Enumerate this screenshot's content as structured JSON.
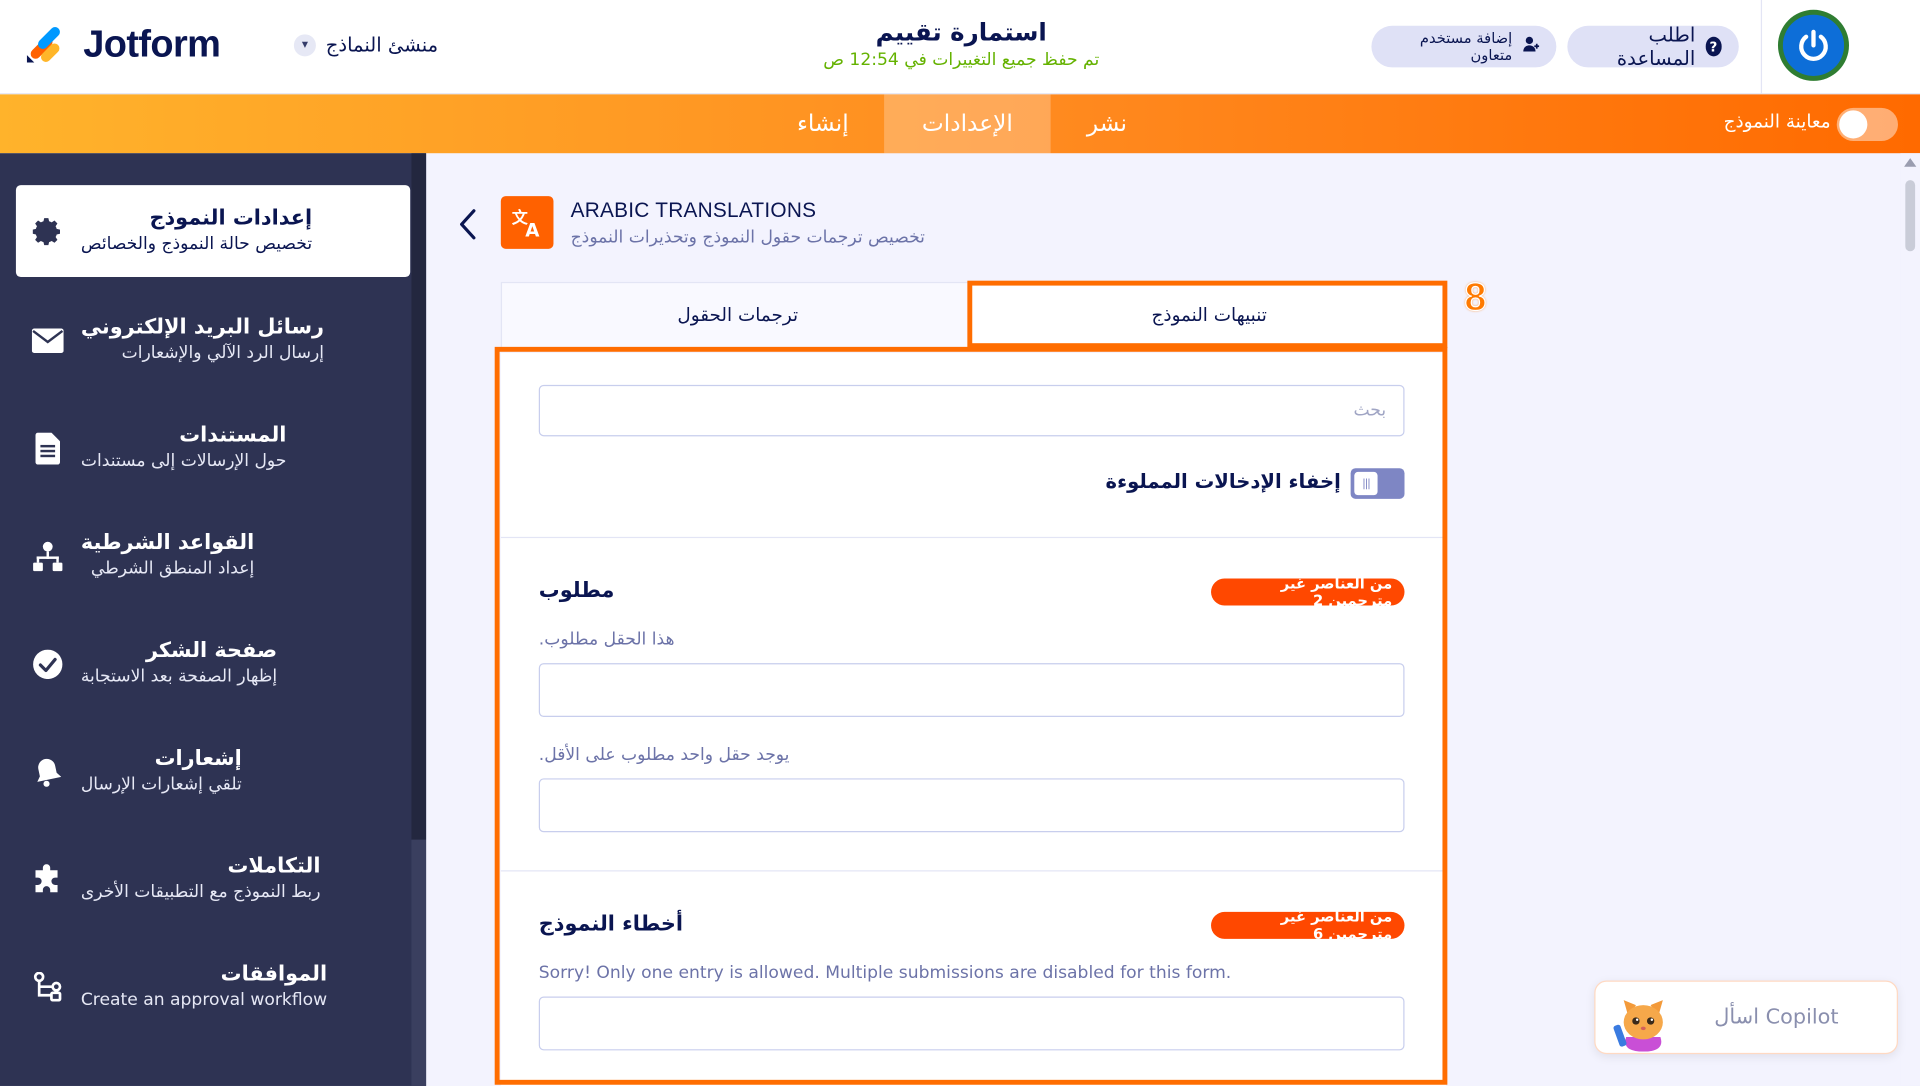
{
  "header": {
    "logo_text": "Jotform",
    "builder_label": "منشئ النماذج",
    "form_title": "استمارة تقييم",
    "save_status": "تم حفظ جميع التغييرات في 12:54 ص",
    "help_label": "اطلب المساعدة",
    "collab_label": "إضافة مستخدم متعاون"
  },
  "nav": {
    "create": "إنشاء",
    "settings": "الإعدادات",
    "publish": "نشر",
    "preview_label": "معاينة النموذج"
  },
  "sidebar": {
    "items": [
      {
        "title": "إعدادات النموذج",
        "subtitle": "تخصيص حالة النموذج والخصائص",
        "icon": "gear-icon"
      },
      {
        "title": "رسائل البريد الإلكتروني",
        "subtitle": "إرسال الرد الآلي والإشعارات",
        "icon": "envelope-icon"
      },
      {
        "title": "المستندات",
        "subtitle": "حول الإرسالات إلى مستندات",
        "icon": "document-icon"
      },
      {
        "title": "القواعد الشرطية",
        "subtitle": "إعداد المنطق الشرطي",
        "icon": "flowchart-icon"
      },
      {
        "title": "صفحة الشكر",
        "subtitle": "إظهار الصفحة بعد الاستجابة",
        "icon": "check-circle-icon"
      },
      {
        "title": "إشعارات",
        "subtitle": "تلقي إشعارات الإرسال",
        "icon": "bell-icon"
      },
      {
        "title": "التكاملات",
        "subtitle": "ربط النموذج مع التطبيقات الأخرى",
        "icon": "puzzle-icon"
      },
      {
        "title": "الموافقات",
        "subtitle": "Create an approval workflow",
        "icon": "approval-flow-icon"
      }
    ]
  },
  "page": {
    "title": "ARABIC TRANSLATIONS",
    "subtitle": "تخصيص ترجمات حقول النموذج وتحذيرات النموذج"
  },
  "tabs": {
    "fields": "ترجمات الحقول",
    "alerts": "تنبيهات النموذج"
  },
  "step_number": "8",
  "panel": {
    "search_placeholder": "بحث",
    "hide_filled_label": "إخفاء الإدخالات المملوءة",
    "sections": [
      {
        "title": "مطلوب",
        "badge": "من العناصر غير مترجمين 2",
        "fields": [
          {
            "label": ".هذا الحقل مطلوب",
            "value": ""
          },
          {
            "label": ".يوجد حقل واحد مطلوب على الأقل",
            "value": ""
          }
        ]
      },
      {
        "title": "أخطاء النموذج",
        "badge": "من العناصر غير مترجمين 6",
        "fields": [
          {
            "label": "Sorry! Only one entry is allowed. Multiple submissions are disabled for this form.",
            "value": ""
          }
        ]
      }
    ]
  },
  "copilot": {
    "label": "اسأل Copilot"
  },
  "colors": {
    "brand_orange": "#ff6100",
    "sidebar_bg": "#2e3353",
    "navy": "#0a1551",
    "badge": "#ff4800",
    "success": "#64b200",
    "highlight": "#ff6d00"
  }
}
